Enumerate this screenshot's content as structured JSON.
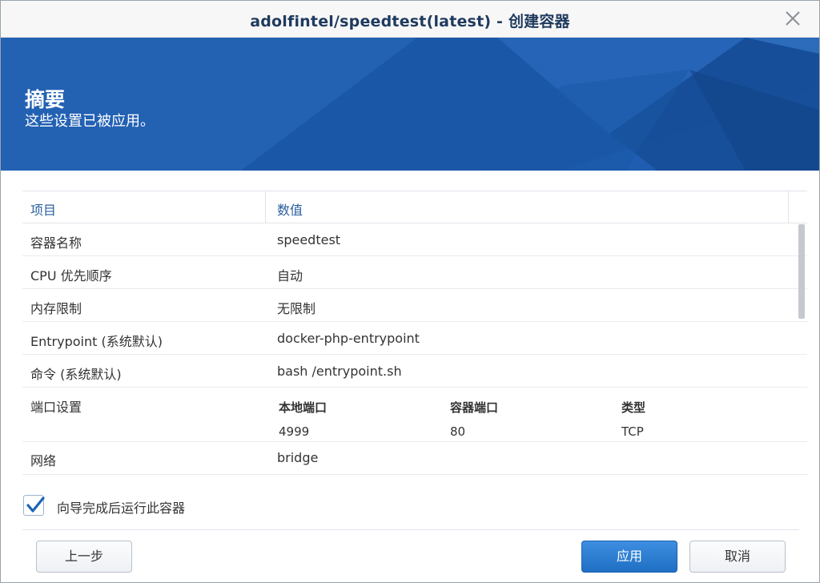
{
  "window": {
    "title": "adolfintel/speedtest(latest) - 创建容器",
    "close_icon": "close-icon"
  },
  "banner": {
    "heading": "摘要",
    "subtitle": "这些设置已被应用。"
  },
  "table": {
    "headers": [
      "项目",
      "数值"
    ],
    "rows": [
      {
        "key": "容器名称",
        "value": "speedtest"
      },
      {
        "key": "CPU 优先顺序",
        "value": "自动"
      },
      {
        "key": "内存限制",
        "value": "无限制"
      },
      {
        "key": "Entrypoint (系统默认)",
        "value": "docker-php-entrypoint"
      },
      {
        "key": "命令 (系统默认)",
        "value": "bash /entrypoint.sh"
      }
    ],
    "ports": {
      "key": "端口设置",
      "headers": [
        "本地端口",
        "容器端口",
        "类型"
      ],
      "values": [
        "4999",
        "80",
        "TCP"
      ]
    },
    "network": {
      "key": "网络",
      "value": "bridge"
    }
  },
  "checkbox": {
    "label": "向导完成后运行此容器",
    "checked": true
  },
  "buttons": {
    "prev": "上一步",
    "apply": "应用",
    "cancel": "取消"
  },
  "colors": {
    "accent": "#1f6fc4",
    "banner": "#1e5db0",
    "title": "#1f3a5f",
    "header_text": "#2a5f9e"
  }
}
